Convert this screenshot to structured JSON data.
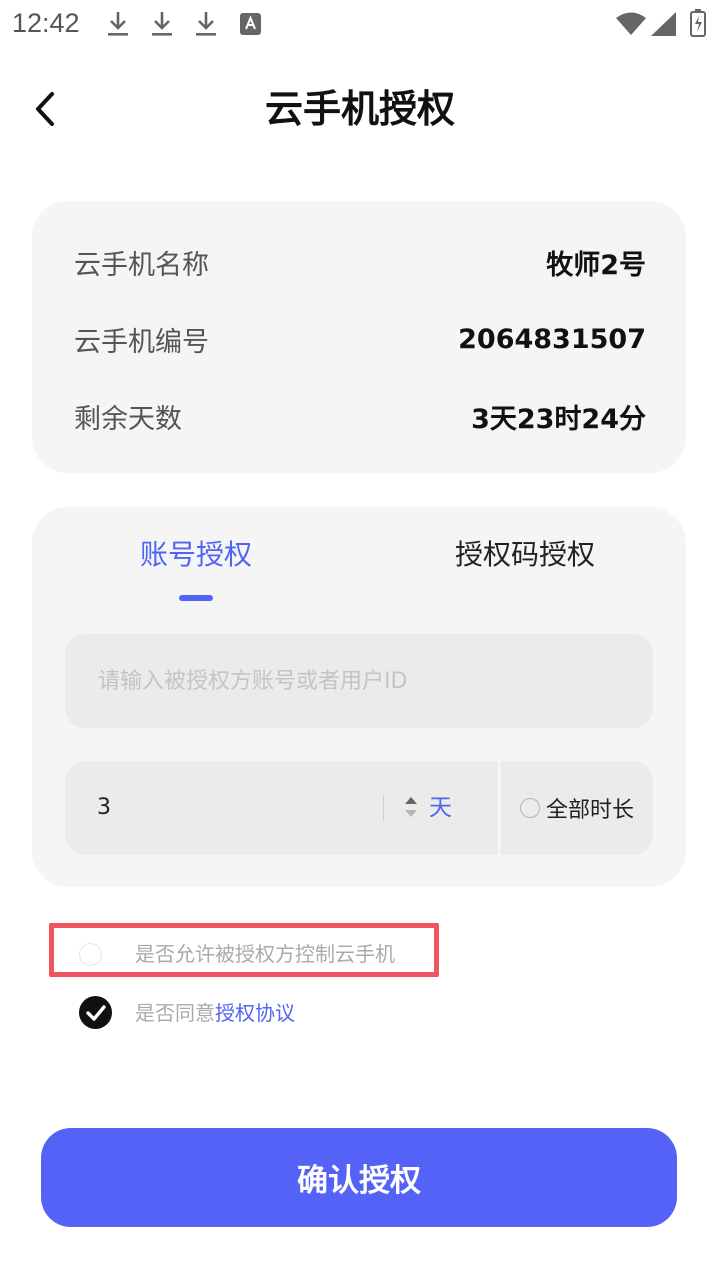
{
  "status_bar": {
    "time": "12:42",
    "icons": [
      "download-icon",
      "download-icon",
      "download-icon",
      "keyboard-a-icon",
      "wifi-icon",
      "signal-icon",
      "battery-icon"
    ]
  },
  "header": {
    "back_icon": "chevron-left-icon",
    "title": "云手机授权"
  },
  "info": {
    "rows": [
      {
        "label": "云手机名称",
        "value": "牧师2号"
      },
      {
        "label": "云手机编号",
        "value": "2064831507"
      },
      {
        "label": "剩余天数",
        "value": "3天23时24分"
      }
    ]
  },
  "auth": {
    "tabs": [
      {
        "label": "账号授权",
        "active": true
      },
      {
        "label": "授权码授权",
        "active": false
      }
    ],
    "account_input": {
      "value": "",
      "placeholder": "请输入被授权方账号或者用户ID"
    },
    "duration": {
      "value": "3",
      "unit": "天"
    },
    "full_duration": {
      "label": "全部时长",
      "checked": false
    }
  },
  "options": {
    "allow_control": {
      "label": "是否允许被授权方控制云手机",
      "checked": false
    },
    "agree": {
      "prefix": "是否同意",
      "link": "授权协议",
      "checked": true
    }
  },
  "confirm_label": "确认授权",
  "colors": {
    "accent": "#5165f5",
    "button": "#5562f7",
    "card": "#f5f5f5",
    "highlight": "#ee5560"
  }
}
